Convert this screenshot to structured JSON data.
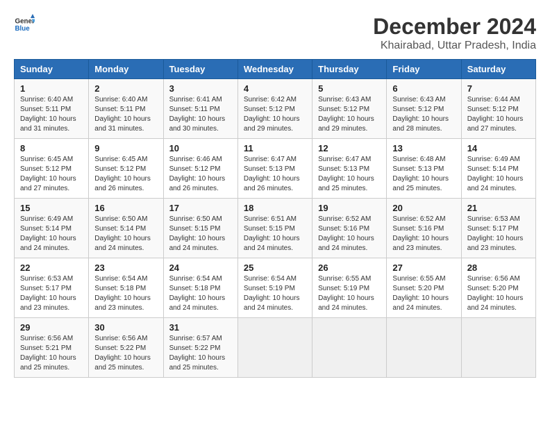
{
  "header": {
    "logo_general": "General",
    "logo_blue": "Blue",
    "title": "December 2024",
    "subtitle": "Khairabad, Uttar Pradesh, India"
  },
  "weekdays": [
    "Sunday",
    "Monday",
    "Tuesday",
    "Wednesday",
    "Thursday",
    "Friday",
    "Saturday"
  ],
  "weeks": [
    [
      {
        "day": "1",
        "sunrise": "6:40 AM",
        "sunset": "5:11 PM",
        "daylight": "10 hours and 31 minutes."
      },
      {
        "day": "2",
        "sunrise": "6:40 AM",
        "sunset": "5:11 PM",
        "daylight": "10 hours and 31 minutes."
      },
      {
        "day": "3",
        "sunrise": "6:41 AM",
        "sunset": "5:11 PM",
        "daylight": "10 hours and 30 minutes."
      },
      {
        "day": "4",
        "sunrise": "6:42 AM",
        "sunset": "5:12 PM",
        "daylight": "10 hours and 29 minutes."
      },
      {
        "day": "5",
        "sunrise": "6:43 AM",
        "sunset": "5:12 PM",
        "daylight": "10 hours and 29 minutes."
      },
      {
        "day": "6",
        "sunrise": "6:43 AM",
        "sunset": "5:12 PM",
        "daylight": "10 hours and 28 minutes."
      },
      {
        "day": "7",
        "sunrise": "6:44 AM",
        "sunset": "5:12 PM",
        "daylight": "10 hours and 27 minutes."
      }
    ],
    [
      {
        "day": "8",
        "sunrise": "6:45 AM",
        "sunset": "5:12 PM",
        "daylight": "10 hours and 27 minutes."
      },
      {
        "day": "9",
        "sunrise": "6:45 AM",
        "sunset": "5:12 PM",
        "daylight": "10 hours and 26 minutes."
      },
      {
        "day": "10",
        "sunrise": "6:46 AM",
        "sunset": "5:12 PM",
        "daylight": "10 hours and 26 minutes."
      },
      {
        "day": "11",
        "sunrise": "6:47 AM",
        "sunset": "5:13 PM",
        "daylight": "10 hours and 26 minutes."
      },
      {
        "day": "12",
        "sunrise": "6:47 AM",
        "sunset": "5:13 PM",
        "daylight": "10 hours and 25 minutes."
      },
      {
        "day": "13",
        "sunrise": "6:48 AM",
        "sunset": "5:13 PM",
        "daylight": "10 hours and 25 minutes."
      },
      {
        "day": "14",
        "sunrise": "6:49 AM",
        "sunset": "5:14 PM",
        "daylight": "10 hours and 24 minutes."
      }
    ],
    [
      {
        "day": "15",
        "sunrise": "6:49 AM",
        "sunset": "5:14 PM",
        "daylight": "10 hours and 24 minutes."
      },
      {
        "day": "16",
        "sunrise": "6:50 AM",
        "sunset": "5:14 PM",
        "daylight": "10 hours and 24 minutes."
      },
      {
        "day": "17",
        "sunrise": "6:50 AM",
        "sunset": "5:15 PM",
        "daylight": "10 hours and 24 minutes."
      },
      {
        "day": "18",
        "sunrise": "6:51 AM",
        "sunset": "5:15 PM",
        "daylight": "10 hours and 24 minutes."
      },
      {
        "day": "19",
        "sunrise": "6:52 AM",
        "sunset": "5:16 PM",
        "daylight": "10 hours and 24 minutes."
      },
      {
        "day": "20",
        "sunrise": "6:52 AM",
        "sunset": "5:16 PM",
        "daylight": "10 hours and 23 minutes."
      },
      {
        "day": "21",
        "sunrise": "6:53 AM",
        "sunset": "5:17 PM",
        "daylight": "10 hours and 23 minutes."
      }
    ],
    [
      {
        "day": "22",
        "sunrise": "6:53 AM",
        "sunset": "5:17 PM",
        "daylight": "10 hours and 23 minutes."
      },
      {
        "day": "23",
        "sunrise": "6:54 AM",
        "sunset": "5:18 PM",
        "daylight": "10 hours and 23 minutes."
      },
      {
        "day": "24",
        "sunrise": "6:54 AM",
        "sunset": "5:18 PM",
        "daylight": "10 hours and 24 minutes."
      },
      {
        "day": "25",
        "sunrise": "6:54 AM",
        "sunset": "5:19 PM",
        "daylight": "10 hours and 24 minutes."
      },
      {
        "day": "26",
        "sunrise": "6:55 AM",
        "sunset": "5:19 PM",
        "daylight": "10 hours and 24 minutes."
      },
      {
        "day": "27",
        "sunrise": "6:55 AM",
        "sunset": "5:20 PM",
        "daylight": "10 hours and 24 minutes."
      },
      {
        "day": "28",
        "sunrise": "6:56 AM",
        "sunset": "5:20 PM",
        "daylight": "10 hours and 24 minutes."
      }
    ],
    [
      {
        "day": "29",
        "sunrise": "6:56 AM",
        "sunset": "5:21 PM",
        "daylight": "10 hours and 25 minutes."
      },
      {
        "day": "30",
        "sunrise": "6:56 AM",
        "sunset": "5:22 PM",
        "daylight": "10 hours and 25 minutes."
      },
      {
        "day": "31",
        "sunrise": "6:57 AM",
        "sunset": "5:22 PM",
        "daylight": "10 hours and 25 minutes."
      },
      null,
      null,
      null,
      null
    ]
  ]
}
